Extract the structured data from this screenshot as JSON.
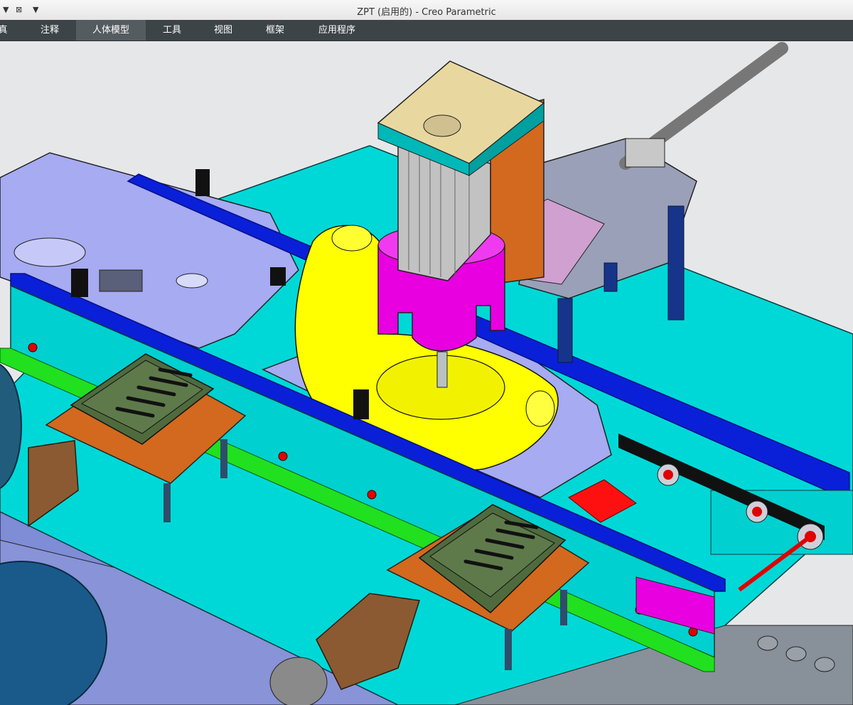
{
  "quick_access": {
    "dropdown_icon": "caret-down-icon",
    "close_windows_icon": "close-windows-icon",
    "more_icon": "caret-down-icon"
  },
  "window": {
    "title": "ZPT (启用的) - Creo Parametric"
  },
  "menu": {
    "tabs": [
      {
        "label": "真"
      },
      {
        "label": "注释"
      },
      {
        "label": "人体模型",
        "active": true
      },
      {
        "label": "工具"
      },
      {
        "label": "视图"
      },
      {
        "label": "框架"
      },
      {
        "label": "应用程序"
      }
    ]
  },
  "colors": {
    "menubar": "#3d4447",
    "active_tab": "#545c60",
    "viewport_bg": "#e6e7e9",
    "table_cyan": "#00d8d8",
    "rail_blue": "#0a1fd8",
    "part_yellow": "#ffff00",
    "holder_magenta": "#e800e0",
    "plate_orange": "#d2691e",
    "strip_green": "#20e020"
  }
}
